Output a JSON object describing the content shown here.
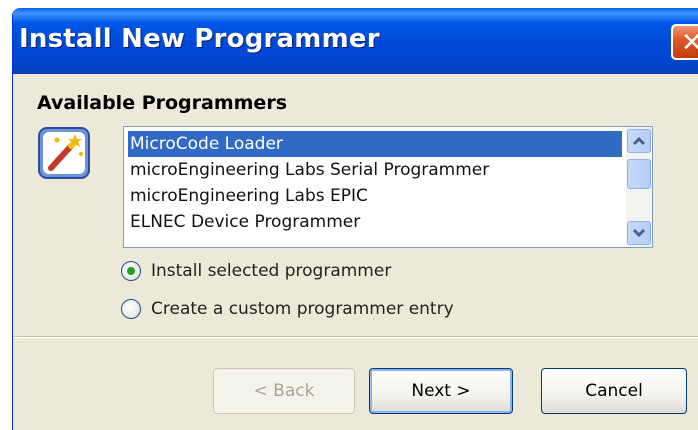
{
  "window": {
    "title": "Install New Programmer",
    "close_label": "✕"
  },
  "section": {
    "heading": "Available Programmers"
  },
  "programmers": {
    "items": [
      "MicroCode Loader",
      "microEngineering Labs Serial Programmer",
      "microEngineering Labs EPIC",
      "ELNEC Device Programmer"
    ],
    "selected_index": 0
  },
  "options": {
    "install_selected": "Install selected programmer",
    "create_custom": "Create a custom programmer entry",
    "selected": "install_selected"
  },
  "buttons": {
    "back": "< Back",
    "next": "Next >",
    "cancel": "Cancel"
  },
  "colors": {
    "titlebar": "#0048d8",
    "selection": "#316ac5",
    "dialog_bg": "#ece9d8",
    "close": "#e15a2a",
    "radio_dot": "#21a121"
  },
  "icons": {
    "wizard": "wand-wizard-icon",
    "close": "close-icon",
    "scroll_up": "chevron-up-icon",
    "scroll_down": "chevron-down-icon"
  }
}
